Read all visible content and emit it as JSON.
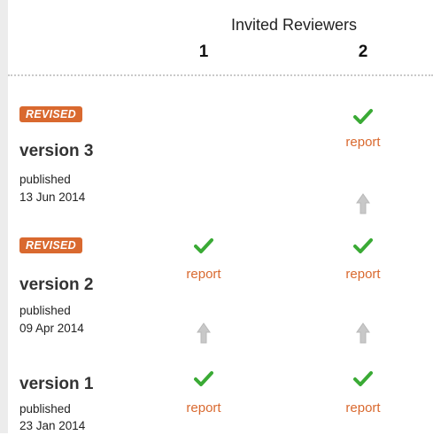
{
  "header": {
    "title": "Invited Reviewers",
    "col1": "1",
    "col2": "2"
  },
  "colors": {
    "accent": "#d9692f",
    "check": "#3aaa35",
    "arrow": "#c8c8c8"
  },
  "icons": {
    "approved": "checkmark-icon",
    "arrow": "arrow-up-icon"
  },
  "versions": [
    {
      "badge": "REVISED",
      "title": "version 3",
      "published": "published",
      "date": "13 Jun 2014"
    },
    {
      "badge": "REVISED",
      "title": "version 2",
      "published": "published",
      "date": "09 Apr 2014"
    },
    {
      "title": "version 1",
      "published": "published",
      "date": "23 Jan 2014"
    }
  ],
  "reports": {
    "v3r2": "report",
    "v2r1": "report",
    "v2r2": "report",
    "v1r1": "report",
    "v1r2": "report"
  }
}
